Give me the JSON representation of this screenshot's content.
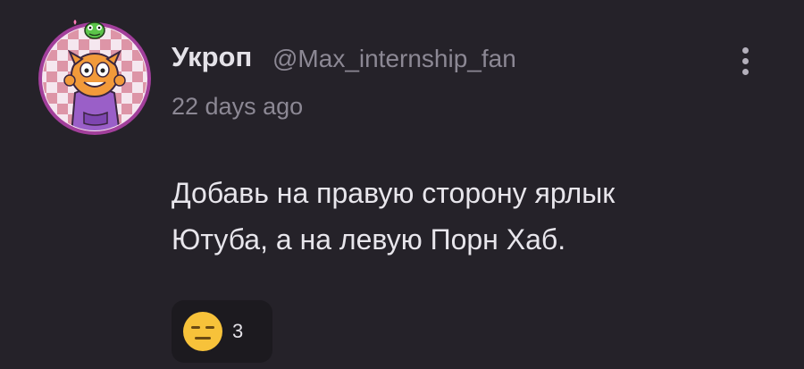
{
  "comment": {
    "author": {
      "display_name": "Укроп",
      "handle": "@Max_internship_fan",
      "avatar_icon": "cartoon-monster-avatar-icon"
    },
    "timestamp": "22 days ago",
    "text_line1": "Добавь на правую сторону ярлык",
    "text_line2": "Ютуба, а на левую Порн Хаб.",
    "more_icon": "vertical-ellipsis-icon",
    "reaction": {
      "emoji_icon": "expressionless-face-icon",
      "count": "3"
    }
  },
  "colors": {
    "background": "#252229",
    "avatar_ring": "#a23f9b",
    "primary_text": "#e8e6ec",
    "secondary_text": "#8c8894",
    "reaction_bg": "#1c1a1f",
    "emoji": "#f7c23a"
  }
}
